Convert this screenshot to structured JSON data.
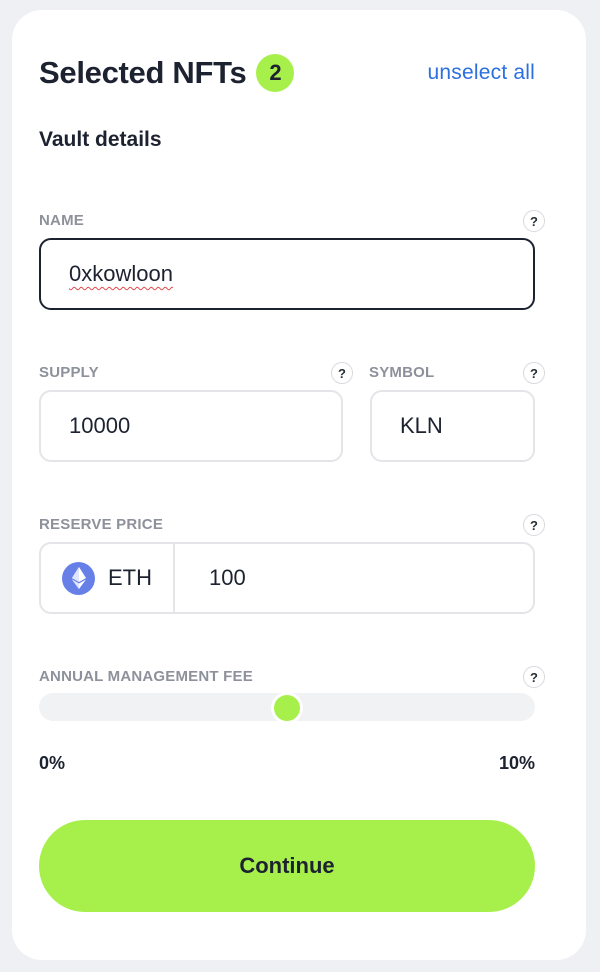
{
  "header": {
    "title": "Selected NFTs",
    "count": "2",
    "unselect_label": "unselect all"
  },
  "vault": {
    "section_title": "Vault details",
    "name": {
      "label": "NAME",
      "value": "0xkowloon",
      "help": "?"
    },
    "supply": {
      "label": "SUPPLY",
      "value": "10000",
      "help": "?"
    },
    "symbol": {
      "label": "SYMBOL",
      "value": "KLN",
      "help": "?"
    },
    "reserve_price": {
      "label": "RESERVE PRICE",
      "currency": "ETH",
      "currency_icon": "ethereum-icon",
      "value": "100",
      "help": "?"
    },
    "management_fee": {
      "label": "ANNUAL MANAGEMENT FEE",
      "help": "?",
      "min_label": "0%",
      "max_label": "10%",
      "min": 0,
      "max": 10,
      "value": 5
    }
  },
  "actions": {
    "continue_label": "Continue"
  },
  "colors": {
    "accent": "#a7ef4a",
    "link": "#2b6fe0",
    "eth": "#6780e8",
    "text": "#1c2230",
    "label": "#8c919b"
  }
}
